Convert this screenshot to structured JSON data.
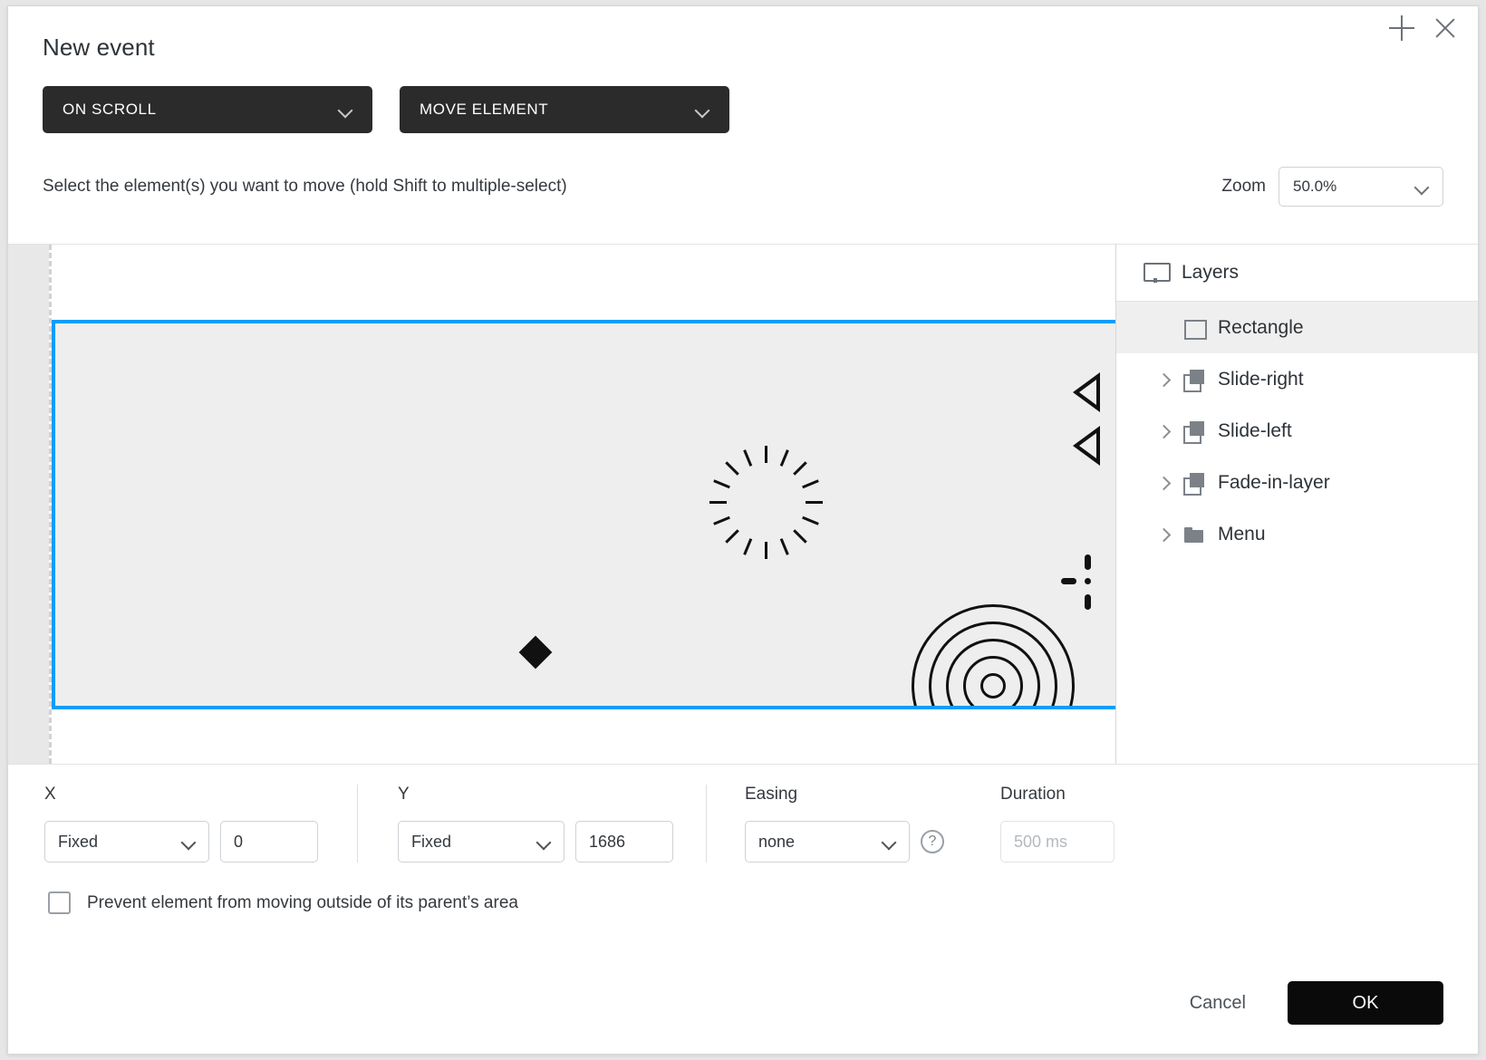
{
  "dialog": {
    "title": "New event",
    "add_label": "+",
    "close_label": "×"
  },
  "triggers": {
    "event_type": "ON SCROLL",
    "action_type": "MOVE ELEMENT"
  },
  "instruction": "Select the element(s) you want to move (hold Shift to multiple-select)",
  "zoom": {
    "label": "Zoom",
    "value": "50.0%"
  },
  "layers": {
    "title": "Layers",
    "items": [
      {
        "label": "Rectangle",
        "icon": "rectangle-icon",
        "expandable": false,
        "selected": true
      },
      {
        "label": "Slide-right",
        "icon": "group-icon",
        "expandable": true,
        "selected": false
      },
      {
        "label": "Slide-left",
        "icon": "group-icon",
        "expandable": true,
        "selected": false
      },
      {
        "label": "Fade-in-layer",
        "icon": "group-icon",
        "expandable": true,
        "selected": false
      },
      {
        "label": "Menu",
        "icon": "folder-icon",
        "expandable": true,
        "selected": false
      }
    ]
  },
  "form": {
    "x": {
      "label": "X",
      "mode": "Fixed",
      "value": "0"
    },
    "y": {
      "label": "Y",
      "mode": "Fixed",
      "value": "1686"
    },
    "easing": {
      "label": "Easing",
      "value": "none",
      "help": "?"
    },
    "duration": {
      "label": "Duration",
      "placeholder": "500 ms",
      "value": ""
    },
    "prevent_checkbox": {
      "label": "Prevent element from moving outside of its parent’s area",
      "checked": false
    }
  },
  "footer": {
    "cancel_label": "Cancel",
    "ok_label": "OK"
  },
  "colors": {
    "accent_blue": "#0b9dfb",
    "dark_control": "#2b2b2b",
    "ok_button": "#0a0a0a",
    "canvas_gray": "#eeeeee"
  }
}
